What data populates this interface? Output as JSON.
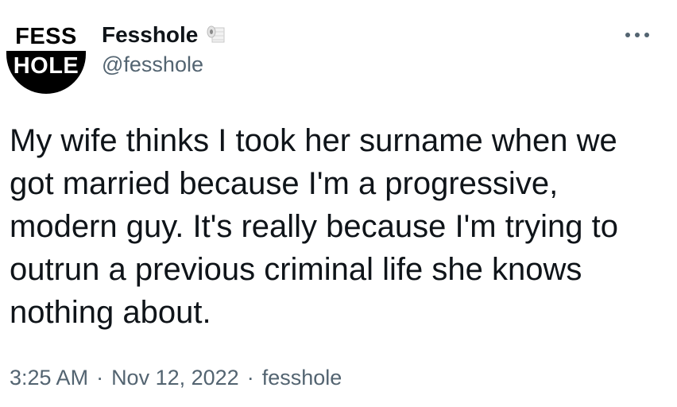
{
  "author": {
    "avatar_top": "FESS",
    "avatar_bottom": "HOLE",
    "display_name": "Fesshole",
    "badge_icon": "toilet-paper-icon",
    "handle": "@fesshole"
  },
  "tweet": {
    "text": "My wife thinks I took her surname when we got married because I'm a progressive, modern guy. It's really because I'm trying to outrun a previous criminal life she knows nothing about."
  },
  "meta": {
    "time": "3:25 AM",
    "separator": "·",
    "date": "Nov 12, 2022",
    "source": "fesshole"
  },
  "actions": {
    "more_icon": "more-horizontal-icon"
  },
  "colors": {
    "text_primary": "#0f1419",
    "text_secondary": "#536471",
    "background": "#ffffff"
  }
}
